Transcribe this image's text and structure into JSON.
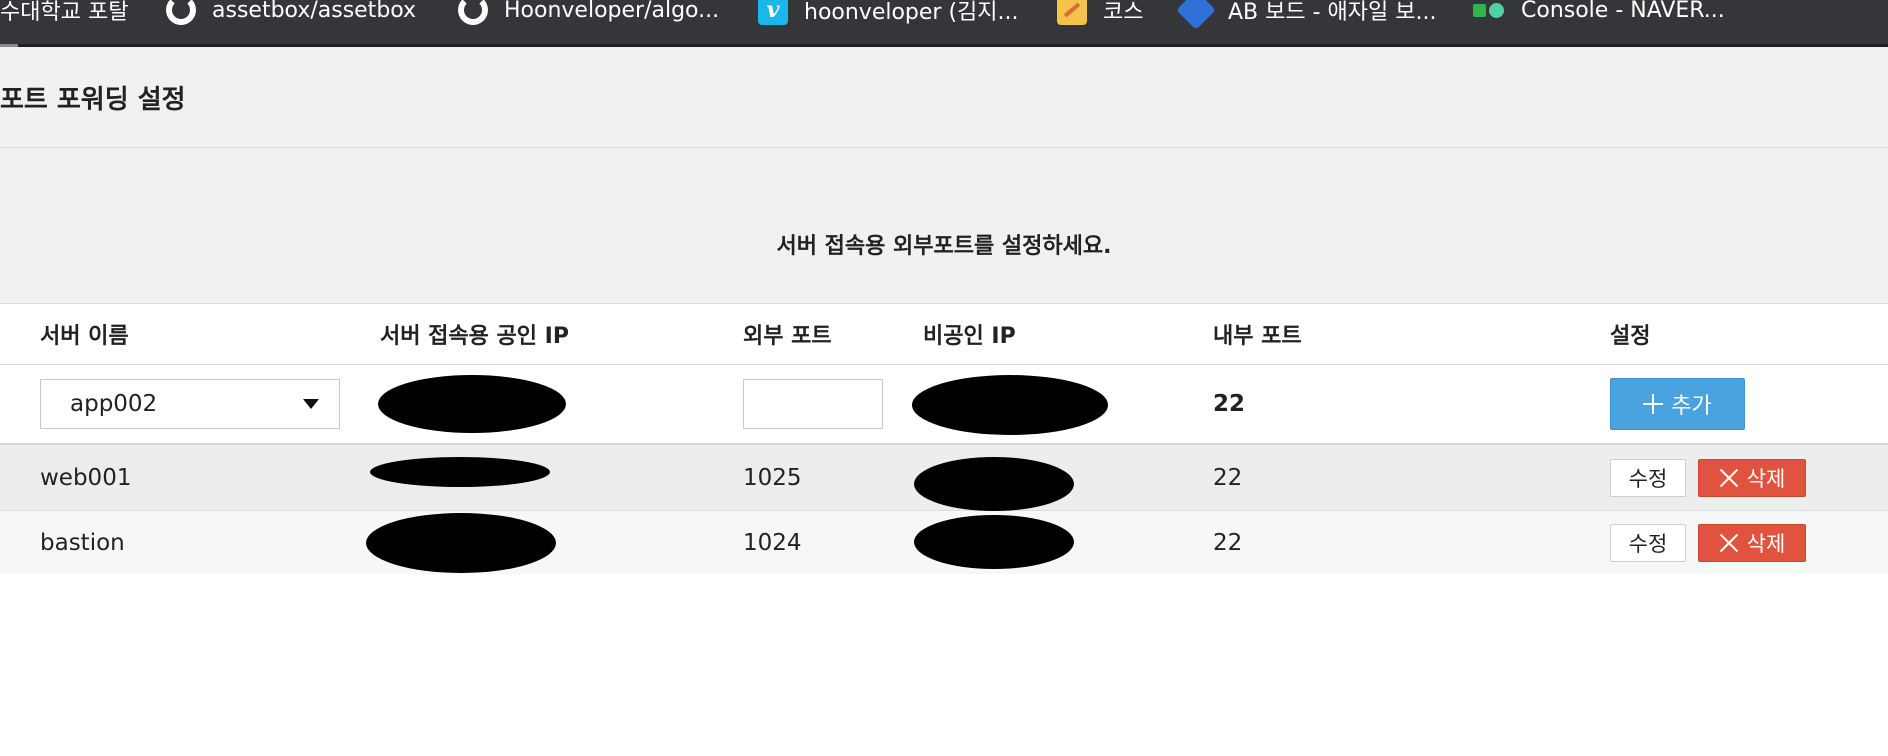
{
  "bookmarks": [
    {
      "label": "수대학교 포탈",
      "icon": "none"
    },
    {
      "label": "assetbox/assetbox",
      "icon": "github-icon"
    },
    {
      "label": "Hoonveloper/algo...",
      "icon": "github-icon"
    },
    {
      "label": "hoonveloper (김지...",
      "icon": "vimeo-icon"
    },
    {
      "label": "코스",
      "icon": "notes-icon"
    },
    {
      "label": "AB 보드 - 애자일 보...",
      "icon": "jira-icon"
    },
    {
      "label": "Console - NAVER...",
      "icon": "naver-cloud-icon"
    }
  ],
  "page": {
    "title": "포트 포워딩 설정",
    "subtitle": "서버 접속용 외부포트를 설정하세요."
  },
  "table": {
    "headers": {
      "server_name": "서버 이름",
      "public_ip": "서버 접속용 공인 IP",
      "external_port": "외부 포트",
      "private_ip": "비공인 IP",
      "internal_port": "내부 포트",
      "settings": "설정"
    },
    "input_row": {
      "server_select": "app002",
      "external_port_value": "",
      "internal_port": "22",
      "add_label": "추가"
    },
    "rows": [
      {
        "server_name": "web001",
        "external_port": "1025",
        "internal_port": "22",
        "edit_label": "수정",
        "delete_label": "삭제"
      },
      {
        "server_name": "bastion",
        "external_port": "1024",
        "internal_port": "22",
        "edit_label": "수정",
        "delete_label": "삭제"
      }
    ]
  },
  "colors": {
    "add_button": "#4aa3df",
    "delete_button": "#e0533f",
    "bookmarks_bar": "#35363a"
  }
}
